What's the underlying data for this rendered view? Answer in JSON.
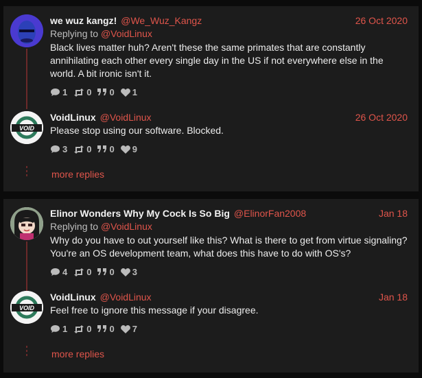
{
  "threads": [
    {
      "parent": {
        "name": "we wuz kangz!",
        "handle": "@We_Wuz_Kangz",
        "date": "26 Oct 2020",
        "replying_prefix": "Replying to",
        "replying_to": "@VoidLinux",
        "text": "Black lives matter huh? Aren't these the same primates that are constantly annihilating each other every single day in the US if not everywhere else in the world. A bit ironic isn't it.",
        "stats": {
          "replies": "1",
          "retweets": "0",
          "quotes": "0",
          "likes": "1"
        }
      },
      "reply": {
        "name": "VoidLinux",
        "handle": "@VoidLinux",
        "date": "26 Oct 2020",
        "text": "Please stop using our software. Blocked.",
        "stats": {
          "replies": "3",
          "retweets": "0",
          "quotes": "0",
          "likes": "9"
        }
      },
      "more_replies": "more replies"
    },
    {
      "parent": {
        "name": "Elinor Wonders Why My Cock Is So Big",
        "handle": "@ElinorFan2008",
        "date": "Jan 18",
        "replying_prefix": "Replying to",
        "replying_to": "@VoidLinux",
        "text": "Why do you have to out yourself like this? What is there to get from virtue signaling? You're an OS development team, what does this have to do with OS's?",
        "stats": {
          "replies": "4",
          "retweets": "0",
          "quotes": "0",
          "likes": "3"
        }
      },
      "reply": {
        "name": "VoidLinux",
        "handle": "@VoidLinux",
        "date": "Jan 18",
        "text": "Feel free to ignore this message if your disagree.",
        "stats": {
          "replies": "1",
          "retweets": "0",
          "quotes": "0",
          "likes": "7"
        }
      },
      "more_replies": "more replies"
    }
  ],
  "void_logo_text": "VOID",
  "colors": {
    "accent": "#e0554b",
    "panel": "#1c1c1c",
    "background": "#0b0b0b",
    "thread_line": "#6b2a2a"
  },
  "icons": {
    "replies": "comment-icon",
    "retweets": "retweet-icon",
    "quotes": "quote-icon",
    "likes": "heart-icon"
  }
}
